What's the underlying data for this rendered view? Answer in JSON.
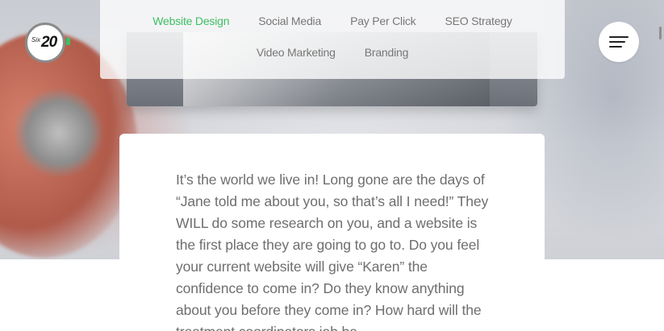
{
  "nav": {
    "row1": [
      "Website Design",
      "Social Media",
      "Pay Per Click",
      "SEO Strategy"
    ],
    "row2": [
      "Video Marketing",
      "Branding"
    ],
    "active_color": "#3dbf62"
  },
  "logo": {
    "small": "Six",
    "big": "20"
  },
  "menu": {
    "icon": "hamburger-icon"
  },
  "content": {
    "paragraph": "It’s the world we live in! Long gone are the days of “Jane told me about you, so that’s all I need!” They WILL do some research on you, and a website is the first place they are going to go to. Do you feel your current website will give “Karen” the confidence to come in? Do they know anything about you before they come in? How hard will the treatment coordinators job be"
  }
}
